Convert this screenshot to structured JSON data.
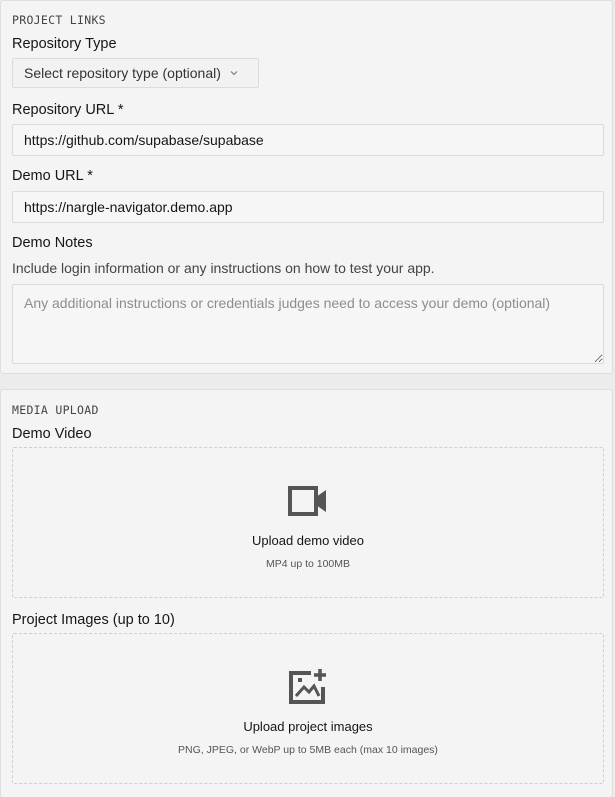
{
  "project_links": {
    "section_title": "PROJECT LINKS",
    "repo_type": {
      "label": "Repository Type",
      "placeholder": "Select repository type (optional)",
      "icon": "chevron-down-icon"
    },
    "repo_url": {
      "label": "Repository URL *",
      "value": "https://github.com/supabase/supabase"
    },
    "demo_url": {
      "label": "Demo URL *",
      "value": "https://nargle-navigator.demo.app"
    },
    "demo_notes": {
      "label": "Demo Notes",
      "hint": "Include login information or any instructions on how to test your app.",
      "placeholder": "Any additional instructions or credentials judges need to access your demo (optional)"
    }
  },
  "media_upload": {
    "section_title": "MEDIA UPLOAD",
    "demo_video": {
      "label": "Demo Video",
      "upload_title": "Upload demo video",
      "upload_hint": "MP4 up to 100MB",
      "icon": "video-camera-icon"
    },
    "project_images": {
      "label": "Project Images (up to 10)",
      "upload_title": "Upload project images",
      "upload_hint": "PNG, JPEG, or WebP up to 5MB each (max 10 images)",
      "icon": "image-add-icon"
    }
  },
  "colors": {
    "background": "#f4f4f4",
    "border": "#dedede",
    "text": "#161616",
    "muted": "#8d8d8d",
    "icon": "#555555"
  }
}
